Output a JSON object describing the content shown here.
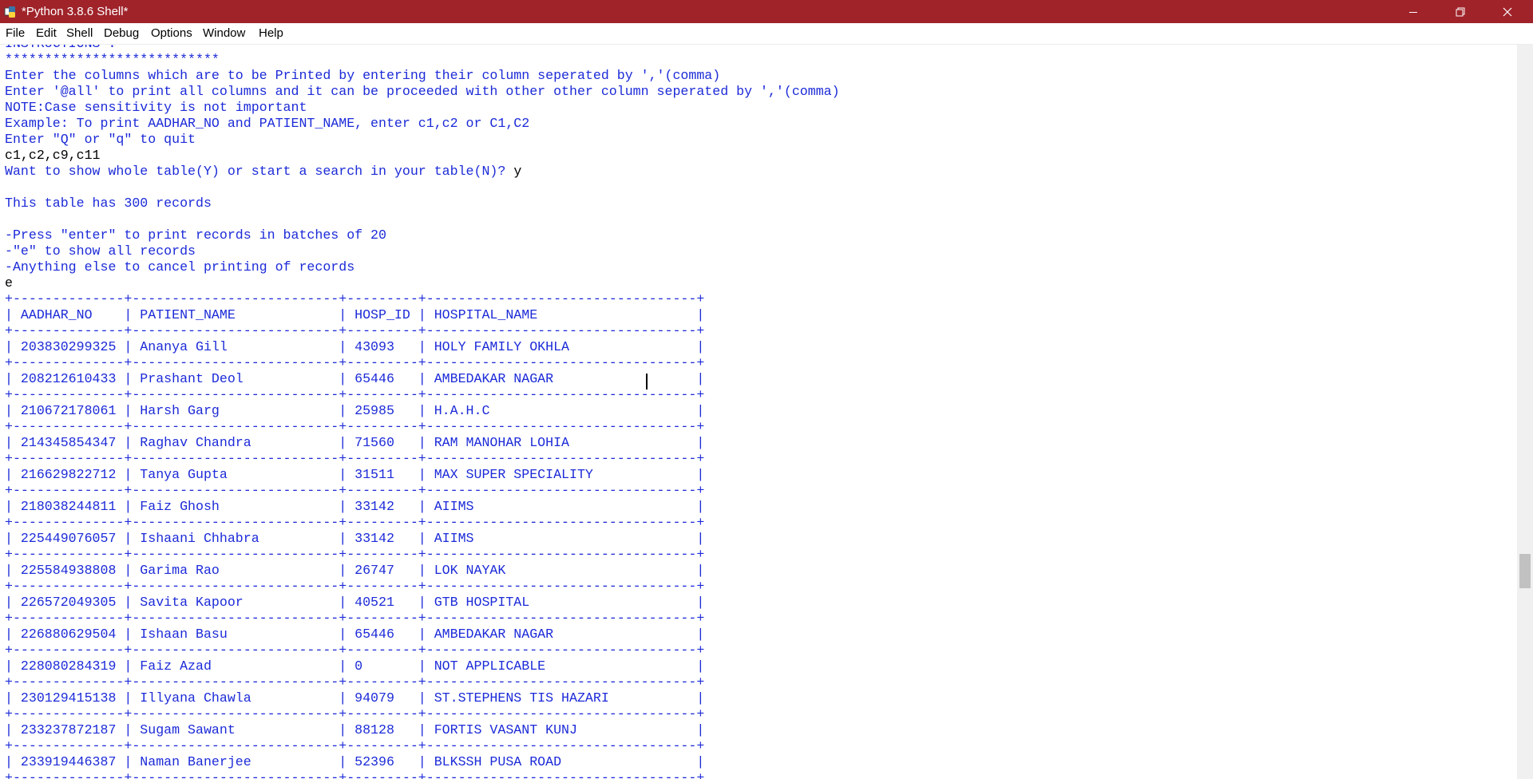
{
  "window": {
    "title": "*Python 3.8.6 Shell*",
    "controls": {
      "minimize": "minimize-icon",
      "restore": "restore-icon",
      "close": "close-icon"
    },
    "accent_color": "#a0232a"
  },
  "menu": [
    "File",
    "Edit",
    "Shell",
    "Debug",
    "Options",
    "Window",
    "Help"
  ],
  "colors": {
    "output": "#1c2bd8",
    "input": "#000000"
  },
  "shell": {
    "lines": [
      {
        "t": "INSTRUCTIONS :",
        "k": "out"
      },
      {
        "t": "***************************",
        "k": "out"
      },
      {
        "t": "Enter the columns which are to be Printed by entering their column seperated by ','(comma)",
        "k": "out"
      },
      {
        "t": "Enter '@all' to print all columns and it can be proceeded with other other column seperated by ','(comma)",
        "k": "out"
      },
      {
        "t": "NOTE:Case sensitivity is not important",
        "k": "out"
      },
      {
        "t": "Example: To print AADHAR_NO and PATIENT_NAME, enter c1,c2 or C1,C2",
        "k": "out"
      },
      {
        "t": "Enter \"Q\" or \"q\" to quit",
        "k": "out"
      },
      {
        "t": "c1,c2,c9,c11",
        "k": "inp"
      },
      {
        "t": "Want to show whole table(Y) or start a search in your table(N)? ",
        "k": "out",
        "suffix": "y"
      },
      {
        "t": "",
        "k": "out"
      },
      {
        "t": "This table has 300 records",
        "k": "out"
      },
      {
        "t": "",
        "k": "out"
      },
      {
        "t": "-Press \"enter\" to print records in batches of 20",
        "k": "out"
      },
      {
        "t": "-\"e\" to show all records",
        "k": "out"
      },
      {
        "t": "-Anything else to cancel printing of records",
        "k": "out"
      },
      {
        "t": "e",
        "k": "inp"
      }
    ],
    "table": {
      "columns": [
        "AADHAR_NO",
        "PATIENT_NAME",
        "HOSP_ID",
        "HOSPITAL_NAME"
      ],
      "rows": [
        [
          "203830299325",
          "Ananya Gill",
          "43093",
          "HOLY FAMILY OKHLA"
        ],
        [
          "208212610433",
          "Prashant Deol",
          "65446",
          "AMBEDAKAR NAGAR"
        ],
        [
          "210672178061",
          "Harsh Garg",
          "25985",
          "H.A.H.C"
        ],
        [
          "214345854347",
          "Raghav Chandra",
          "71560",
          "RAM MANOHAR LOHIA"
        ],
        [
          "216629822712",
          "Tanya Gupta",
          "31511",
          "MAX SUPER SPECIALITY"
        ],
        [
          "218038244811",
          "Faiz Ghosh",
          "33142",
          "AIIMS"
        ],
        [
          "225449076057",
          "Ishaani Chhabra",
          "33142",
          "AIIMS"
        ],
        [
          "225584938808",
          "Garima Rao",
          "26747",
          "LOK NAYAK"
        ],
        [
          "226572049305",
          "Savita Kapoor",
          "40521",
          "GTB HOSPITAL"
        ],
        [
          "226880629504",
          "Ishaan Basu",
          "65446",
          "AMBEDAKAR NAGAR"
        ],
        [
          "228080284319",
          "Faiz Azad",
          "0",
          "NOT APPLICABLE"
        ],
        [
          "230129415138",
          "Illyana Chawla",
          "94079",
          "ST.STEPHENS TIS HAZARI"
        ],
        [
          "233237872187",
          "Sugam Sawant",
          "88128",
          "FORTIS VASANT KUNJ"
        ],
        [
          "233919446387",
          "Naman Banerjee",
          "52396",
          "BLKSSH PUSA ROAD"
        ]
      ]
    }
  }
}
